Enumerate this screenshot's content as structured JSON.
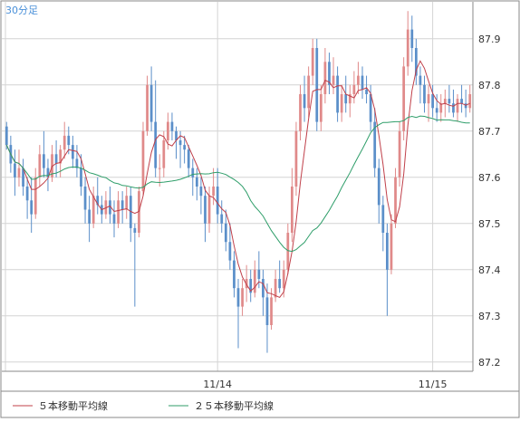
{
  "colors": {
    "background": "#ffffff",
    "frame": "#8a8a8a",
    "grid": "#d4d4d4",
    "up_candle": "#e08a8a",
    "down_candle": "#5b8fc9",
    "ma5": "#c0404a",
    "ma25": "#2f9e6a",
    "timeframe_label": "#4a90d9",
    "axis_text": "#333333"
  },
  "chart_data": {
    "type": "candlestick",
    "timeframe_label": "30分足",
    "y_ticks": [
      87.2,
      87.3,
      87.4,
      87.5,
      87.6,
      87.7,
      87.8,
      87.9
    ],
    "y_range": [
      87.18,
      87.98
    ],
    "x_labels": [
      {
        "label": "11/14",
        "index": 51
      },
      {
        "label": "11/15",
        "index": 103
      }
    ],
    "num_bars": 118,
    "grid": true,
    "candles": [
      {
        "o": 87.71,
        "h": 87.72,
        "l": 87.66,
        "c": 87.67
      },
      {
        "o": 87.67,
        "h": 87.69,
        "l": 87.61,
        "c": 87.63
      },
      {
        "o": 87.63,
        "h": 87.66,
        "l": 87.56,
        "c": 87.6
      },
      {
        "o": 87.6,
        "h": 87.66,
        "l": 87.58,
        "c": 87.62
      },
      {
        "o": 87.62,
        "h": 87.64,
        "l": 87.56,
        "c": 87.58
      },
      {
        "o": 87.58,
        "h": 87.6,
        "l": 87.51,
        "c": 87.55
      },
      {
        "o": 87.55,
        "h": 87.6,
        "l": 87.48,
        "c": 87.52
      },
      {
        "o": 87.52,
        "h": 87.62,
        "l": 87.51,
        "c": 87.6
      },
      {
        "o": 87.6,
        "h": 87.67,
        "l": 87.58,
        "c": 87.65
      },
      {
        "o": 87.65,
        "h": 87.7,
        "l": 87.6,
        "c": 87.62
      },
      {
        "o": 87.62,
        "h": 87.64,
        "l": 87.57,
        "c": 87.6
      },
      {
        "o": 87.6,
        "h": 87.67,
        "l": 87.59,
        "c": 87.65
      },
      {
        "o": 87.65,
        "h": 87.68,
        "l": 87.6,
        "c": 87.63
      },
      {
        "o": 87.63,
        "h": 87.67,
        "l": 87.6,
        "c": 87.66
      },
      {
        "o": 87.66,
        "h": 87.72,
        "l": 87.64,
        "c": 87.69
      },
      {
        "o": 87.69,
        "h": 87.71,
        "l": 87.65,
        "c": 87.67
      },
      {
        "o": 87.67,
        "h": 87.69,
        "l": 87.62,
        "c": 87.64
      },
      {
        "o": 87.64,
        "h": 87.67,
        "l": 87.6,
        "c": 87.62
      },
      {
        "o": 87.62,
        "h": 87.65,
        "l": 87.56,
        "c": 87.58
      },
      {
        "o": 87.58,
        "h": 87.6,
        "l": 87.5,
        "c": 87.53
      },
      {
        "o": 87.53,
        "h": 87.56,
        "l": 87.46,
        "c": 87.5
      },
      {
        "o": 87.5,
        "h": 87.58,
        "l": 87.49,
        "c": 87.56
      },
      {
        "o": 87.56,
        "h": 87.6,
        "l": 87.52,
        "c": 87.54
      },
      {
        "o": 87.54,
        "h": 87.56,
        "l": 87.5,
        "c": 87.52
      },
      {
        "o": 87.52,
        "h": 87.57,
        "l": 87.51,
        "c": 87.55
      },
      {
        "o": 87.55,
        "h": 87.58,
        "l": 87.5,
        "c": 87.52
      },
      {
        "o": 87.52,
        "h": 87.55,
        "l": 87.47,
        "c": 87.5
      },
      {
        "o": 87.5,
        "h": 87.57,
        "l": 87.49,
        "c": 87.55
      },
      {
        "o": 87.55,
        "h": 87.57,
        "l": 87.5,
        "c": 87.53
      },
      {
        "o": 87.53,
        "h": 87.58,
        "l": 87.51,
        "c": 87.56
      },
      {
        "o": 87.56,
        "h": 87.58,
        "l": 87.46,
        "c": 87.49
      },
      {
        "o": 87.49,
        "h": 87.5,
        "l": 87.32,
        "c": 87.48
      },
      {
        "o": 87.48,
        "h": 87.58,
        "l": 87.47,
        "c": 87.57
      },
      {
        "o": 87.57,
        "h": 87.72,
        "l": 87.56,
        "c": 87.7
      },
      {
        "o": 87.7,
        "h": 87.82,
        "l": 87.69,
        "c": 87.8
      },
      {
        "o": 87.8,
        "h": 87.84,
        "l": 87.7,
        "c": 87.72
      },
      {
        "o": 87.72,
        "h": 87.81,
        "l": 87.6,
        "c": 87.62
      },
      {
        "o": 87.62,
        "h": 87.65,
        "l": 87.58,
        "c": 87.62
      },
      {
        "o": 87.62,
        "h": 87.7,
        "l": 87.6,
        "c": 87.68
      },
      {
        "o": 87.68,
        "h": 87.74,
        "l": 87.66,
        "c": 87.72
      },
      {
        "o": 87.72,
        "h": 87.74,
        "l": 87.68,
        "c": 87.7
      },
      {
        "o": 87.7,
        "h": 87.71,
        "l": 87.64,
        "c": 87.68
      },
      {
        "o": 87.68,
        "h": 87.7,
        "l": 87.62,
        "c": 87.67
      },
      {
        "o": 87.67,
        "h": 87.69,
        "l": 87.63,
        "c": 87.66
      },
      {
        "o": 87.66,
        "h": 87.67,
        "l": 87.6,
        "c": 87.62
      },
      {
        "o": 87.62,
        "h": 87.64,
        "l": 87.56,
        "c": 87.6
      },
      {
        "o": 87.6,
        "h": 87.62,
        "l": 87.55,
        "c": 87.58
      },
      {
        "o": 87.58,
        "h": 87.6,
        "l": 87.52,
        "c": 87.56
      },
      {
        "o": 87.56,
        "h": 87.58,
        "l": 87.46,
        "c": 87.5
      },
      {
        "o": 87.5,
        "h": 87.58,
        "l": 87.48,
        "c": 87.56
      },
      {
        "o": 87.56,
        "h": 87.62,
        "l": 87.54,
        "c": 87.58
      },
      {
        "o": 87.58,
        "h": 87.62,
        "l": 87.5,
        "c": 87.52
      },
      {
        "o": 87.52,
        "h": 87.55,
        "l": 87.48,
        "c": 87.5
      },
      {
        "o": 87.5,
        "h": 87.53,
        "l": 87.44,
        "c": 87.46
      },
      {
        "o": 87.46,
        "h": 87.5,
        "l": 87.4,
        "c": 87.42
      },
      {
        "o": 87.42,
        "h": 87.44,
        "l": 87.34,
        "c": 87.36
      },
      {
        "o": 87.36,
        "h": 87.38,
        "l": 87.23,
        "c": 87.32
      },
      {
        "o": 87.32,
        "h": 87.38,
        "l": 87.3,
        "c": 87.36
      },
      {
        "o": 87.36,
        "h": 87.41,
        "l": 87.33,
        "c": 87.38
      },
      {
        "o": 87.38,
        "h": 87.4,
        "l": 87.33,
        "c": 87.35
      },
      {
        "o": 87.35,
        "h": 87.42,
        "l": 87.34,
        "c": 87.4
      },
      {
        "o": 87.4,
        "h": 87.44,
        "l": 87.36,
        "c": 87.38
      },
      {
        "o": 87.38,
        "h": 87.4,
        "l": 87.3,
        "c": 87.34
      },
      {
        "o": 87.34,
        "h": 87.37,
        "l": 87.22,
        "c": 87.28
      },
      {
        "o": 87.28,
        "h": 87.36,
        "l": 87.27,
        "c": 87.34
      },
      {
        "o": 87.34,
        "h": 87.4,
        "l": 87.33,
        "c": 87.38
      },
      {
        "o": 87.38,
        "h": 87.42,
        "l": 87.35,
        "c": 87.36
      },
      {
        "o": 87.36,
        "h": 87.42,
        "l": 87.34,
        "c": 87.4
      },
      {
        "o": 87.4,
        "h": 87.5,
        "l": 87.39,
        "c": 87.48
      },
      {
        "o": 87.48,
        "h": 87.62,
        "l": 87.46,
        "c": 87.58
      },
      {
        "o": 87.58,
        "h": 87.72,
        "l": 87.56,
        "c": 87.7
      },
      {
        "o": 87.7,
        "h": 87.8,
        "l": 87.68,
        "c": 87.78
      },
      {
        "o": 87.78,
        "h": 87.82,
        "l": 87.72,
        "c": 87.75
      },
      {
        "o": 87.75,
        "h": 87.84,
        "l": 87.73,
        "c": 87.82
      },
      {
        "o": 87.82,
        "h": 87.9,
        "l": 87.8,
        "c": 87.88
      },
      {
        "o": 87.88,
        "h": 87.9,
        "l": 87.7,
        "c": 87.72
      },
      {
        "o": 87.72,
        "h": 87.8,
        "l": 87.7,
        "c": 87.78
      },
      {
        "o": 87.78,
        "h": 87.88,
        "l": 87.76,
        "c": 87.85
      },
      {
        "o": 87.85,
        "h": 87.87,
        "l": 87.78,
        "c": 87.8
      },
      {
        "o": 87.8,
        "h": 87.86,
        "l": 87.78,
        "c": 87.82
      },
      {
        "o": 87.82,
        "h": 87.84,
        "l": 87.72,
        "c": 87.74
      },
      {
        "o": 87.74,
        "h": 87.8,
        "l": 87.72,
        "c": 87.78
      },
      {
        "o": 87.78,
        "h": 87.82,
        "l": 87.74,
        "c": 87.76
      },
      {
        "o": 87.76,
        "h": 87.8,
        "l": 87.73,
        "c": 87.78
      },
      {
        "o": 87.78,
        "h": 87.83,
        "l": 87.76,
        "c": 87.8
      },
      {
        "o": 87.8,
        "h": 87.85,
        "l": 87.78,
        "c": 87.82
      },
      {
        "o": 87.82,
        "h": 87.84,
        "l": 87.77,
        "c": 87.79
      },
      {
        "o": 87.79,
        "h": 87.82,
        "l": 87.76,
        "c": 87.78
      },
      {
        "o": 87.78,
        "h": 87.8,
        "l": 87.7,
        "c": 87.72
      },
      {
        "o": 87.72,
        "h": 87.75,
        "l": 87.6,
        "c": 87.62
      },
      {
        "o": 87.62,
        "h": 87.64,
        "l": 87.5,
        "c": 87.54
      },
      {
        "o": 87.54,
        "h": 87.56,
        "l": 87.44,
        "c": 87.48
      },
      {
        "o": 87.48,
        "h": 87.5,
        "l": 87.3,
        "c": 87.4
      },
      {
        "o": 87.4,
        "h": 87.52,
        "l": 87.39,
        "c": 87.5
      },
      {
        "o": 87.5,
        "h": 87.62,
        "l": 87.49,
        "c": 87.6
      },
      {
        "o": 87.6,
        "h": 87.72,
        "l": 87.58,
        "c": 87.7
      },
      {
        "o": 87.7,
        "h": 87.86,
        "l": 87.68,
        "c": 87.84
      },
      {
        "o": 87.84,
        "h": 87.96,
        "l": 87.82,
        "c": 87.92
      },
      {
        "o": 87.92,
        "h": 87.95,
        "l": 87.85,
        "c": 87.88
      },
      {
        "o": 87.88,
        "h": 87.9,
        "l": 87.8,
        "c": 87.82
      },
      {
        "o": 87.82,
        "h": 87.84,
        "l": 87.76,
        "c": 87.8
      },
      {
        "o": 87.8,
        "h": 87.82,
        "l": 87.74,
        "c": 87.76
      },
      {
        "o": 87.76,
        "h": 87.8,
        "l": 87.72,
        "c": 87.78
      },
      {
        "o": 87.78,
        "h": 87.8,
        "l": 87.73,
        "c": 87.75
      },
      {
        "o": 87.75,
        "h": 87.78,
        "l": 87.72,
        "c": 87.74
      },
      {
        "o": 87.74,
        "h": 87.78,
        "l": 87.72,
        "c": 87.76
      },
      {
        "o": 87.76,
        "h": 87.79,
        "l": 87.73,
        "c": 87.77
      },
      {
        "o": 87.77,
        "h": 87.8,
        "l": 87.74,
        "c": 87.76
      },
      {
        "o": 87.76,
        "h": 87.79,
        "l": 87.73,
        "c": 87.74
      },
      {
        "o": 87.74,
        "h": 87.78,
        "l": 87.72,
        "c": 87.77
      },
      {
        "o": 87.77,
        "h": 87.8,
        "l": 87.74,
        "c": 87.76
      },
      {
        "o": 87.76,
        "h": 87.79,
        "l": 87.73,
        "c": 87.75
      },
      {
        "o": 87.75,
        "h": 87.8,
        "l": 87.74,
        "c": 87.78
      }
    ],
    "series": [
      {
        "name": "５本移動平均線",
        "color": "#c0404a",
        "period": 5
      },
      {
        "name": "２５本移動平均線",
        "color": "#2f9e6a",
        "period": 25
      }
    ]
  }
}
